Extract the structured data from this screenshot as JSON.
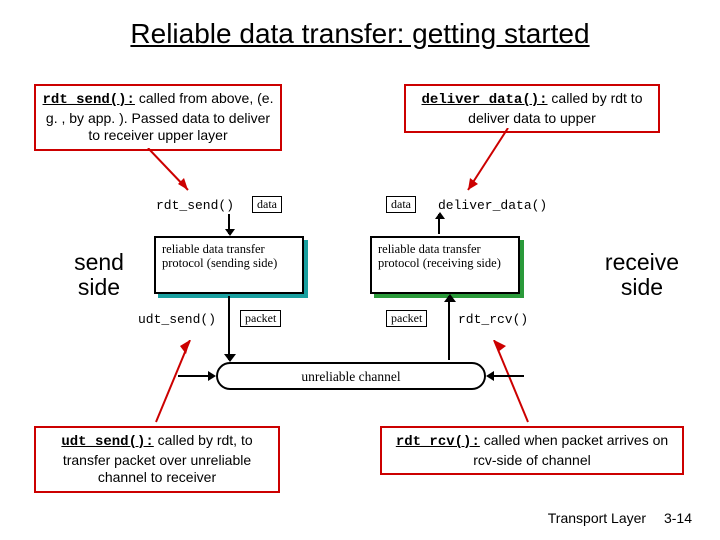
{
  "title": "Reliable data transfer: getting started",
  "callouts": {
    "rdt_send": {
      "fn": "rdt_send():",
      "text": " called from above, (e. g. , by app. ). Passed data to deliver to receiver upper layer"
    },
    "deliver_data": {
      "fn": "deliver_data():",
      "text": " called by rdt to deliver data to upper"
    },
    "udt_send": {
      "fn": "udt_send():",
      "text": " called by rdt, to transfer packet over unreliable channel to receiver"
    },
    "rdt_rcv": {
      "fn": "rdt_rcv():",
      "text": " called when packet arrives on rcv-side of channel"
    }
  },
  "side_labels": {
    "send": "send side",
    "receive": "receive side"
  },
  "diagram": {
    "fn_rdt_send": "rdt_send()",
    "fn_deliver": "deliver_data()",
    "fn_udt_send": "udt_send()",
    "fn_rdt_rcv": "rdt_rcv()",
    "data_tag": "data",
    "packet_tag": "packet",
    "proto_send": "reliable data transfer protocol (sending side)",
    "proto_recv": "reliable data transfer protocol (receiving side)",
    "uchannel": "unreliable channel"
  },
  "footer": {
    "chapter": "Transport Layer",
    "page": "3-14"
  }
}
